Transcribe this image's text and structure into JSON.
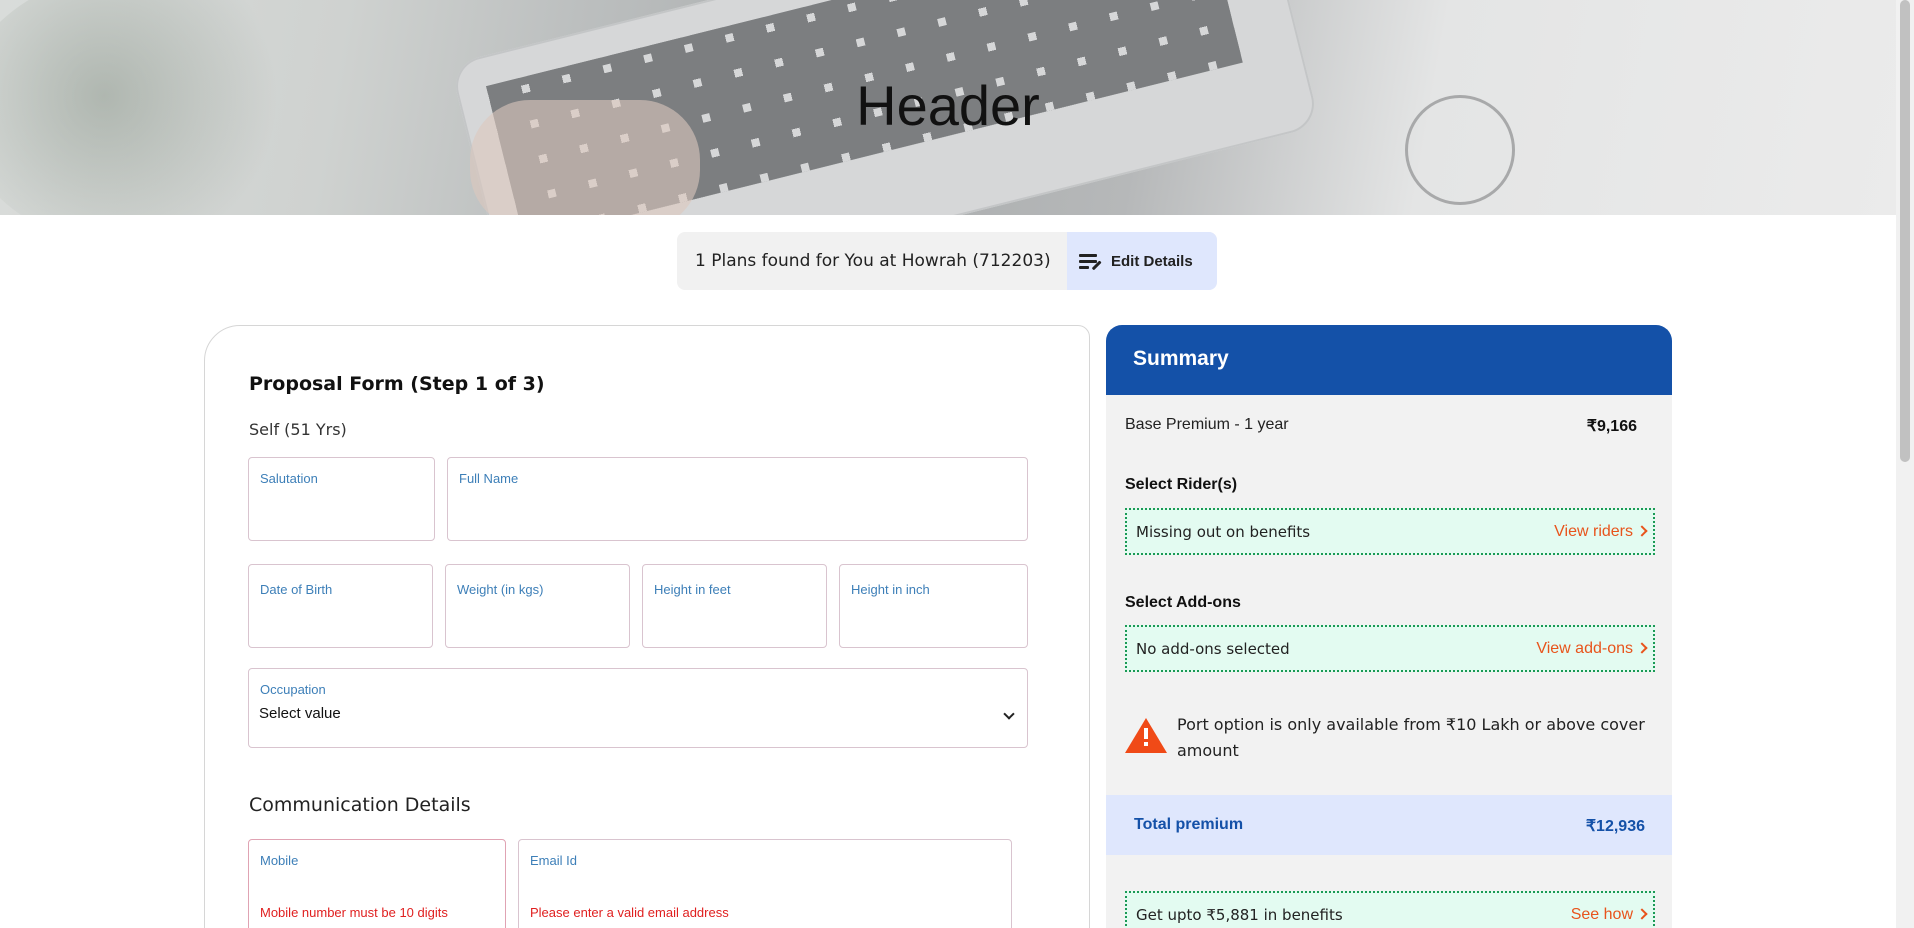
{
  "header": {
    "title": "Header"
  },
  "plans_bar": {
    "text": "1 Plans found for You at Howrah (712203)",
    "edit_label": "Edit Details"
  },
  "form": {
    "title": "Proposal Form (Step 1 of 3)",
    "member": "Self (51 Yrs)",
    "fields": {
      "salutation": "Salutation",
      "full_name": "Full Name",
      "dob": "Date of Birth",
      "weight": "Weight (in kgs)",
      "height_feet": "Height in feet",
      "height_inch": "Height in inch",
      "occupation": "Occupation",
      "occupation_value": "Select value",
      "mobile": "Mobile",
      "mobile_error": "Mobile number must be 10 digits",
      "email": "Email Id",
      "email_error": "Please enter a valid email address"
    },
    "communication_title": "Communication Details"
  },
  "summary": {
    "title": "Summary",
    "base_premium_label": "Base Premium - 1 year",
    "base_premium_value": "₹9,166",
    "riders_title": "Select Rider(s)",
    "riders_text": "Missing out on benefits",
    "riders_link": "View riders",
    "addons_title": "Select Add-ons",
    "addons_text": "No add-ons selected",
    "addons_link": "View add-ons",
    "warning": "Port option is only available from ₹10 Lakh or above cover amount",
    "total_label": "Total premium",
    "total_value": "₹12,936",
    "benefits_text": "Get upto ₹5,881 in benefits",
    "benefits_link": "See how"
  }
}
